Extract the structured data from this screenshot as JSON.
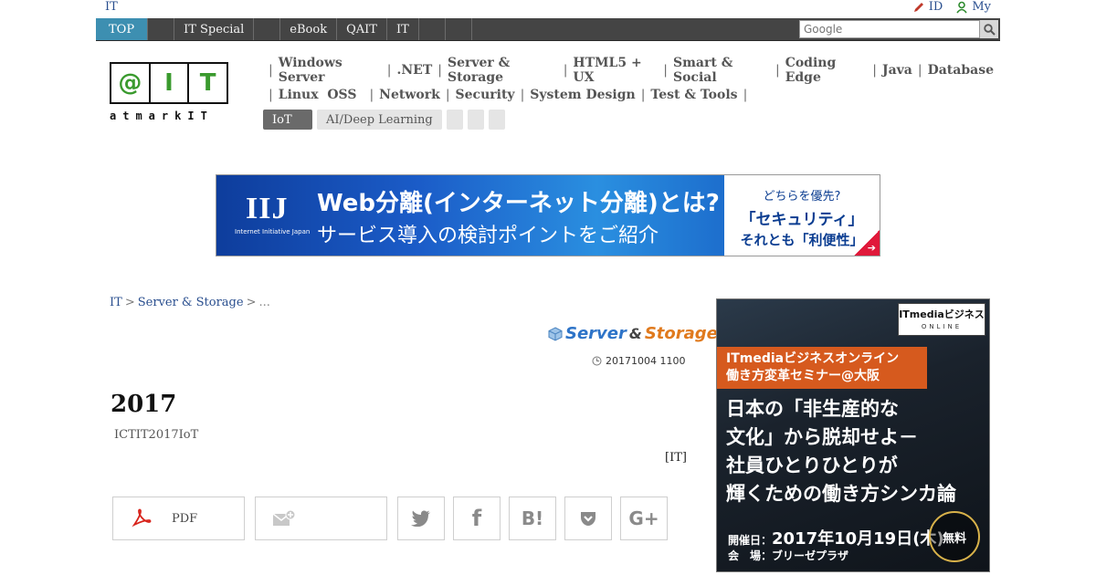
{
  "top_strip": {
    "brand": "IT",
    "links": [
      {
        "label": "ID",
        "icon": "pencil-icon"
      },
      {
        "label": "My",
        "icon": "user-icon"
      }
    ]
  },
  "navbar": {
    "items": [
      {
        "label": "TOP",
        "active": true
      },
      {
        "label": ""
      },
      {
        "label": "IT Special"
      },
      {
        "label": ""
      },
      {
        "label": "eBook"
      },
      {
        "label": "QAIT"
      },
      {
        "label": "IT"
      },
      {
        "label": ""
      },
      {
        "label": ""
      }
    ],
    "search_placeholder": "Google"
  },
  "logo": {
    "boxes": [
      "@",
      "I",
      "T"
    ],
    "tagline": "atmarkIT"
  },
  "categories": {
    "row1": [
      "Windows Server",
      ".NET",
      "Server & Storage",
      "HTML5 + UX",
      "Smart & Social",
      "Coding Edge",
      "Java",
      "Database"
    ],
    "row2": [
      "Linux  OSS",
      "Network",
      "Security",
      "System Design",
      "Test & Tools"
    ],
    "chips": [
      {
        "label": "IoT",
        "style": "dark"
      },
      {
        "label": "AI/Deep Learning",
        "style": "light"
      },
      {
        "label": "",
        "style": "blank"
      },
      {
        "label": "",
        "style": "blank"
      },
      {
        "label": "",
        "style": "blank"
      }
    ]
  },
  "banner": {
    "logo": "IIJ",
    "logo_sub": "Internet Initiative Japan",
    "line1": "Web分離(インターネット分離)とは?",
    "line2": "サービス導入の検討ポイントをご紹介",
    "right1": "どちらを優先?",
    "right2": "「セキュリティ」",
    "right3": "それとも「利便性」"
  },
  "breadcrumb": {
    "items": [
      "IT",
      "Server & Storage"
    ],
    "current": "..."
  },
  "section_logo": {
    "part1": "Server",
    "amp": "&",
    "part2": "Storage"
  },
  "article": {
    "date": "20171004 1100",
    "title": "2017",
    "subtitle": "ICTIT2017IoT",
    "source": "[IT]"
  },
  "share": {
    "pdf_label": "PDF",
    "buttons": [
      {
        "name": "twitter",
        "glyph": "🐦"
      },
      {
        "name": "facebook",
        "glyph": "f"
      },
      {
        "name": "hatena",
        "glyph": "B!"
      },
      {
        "name": "pocket",
        "glyph": "pocket"
      },
      {
        "name": "google-plus",
        "glyph": "G+"
      }
    ]
  },
  "side_ad": {
    "brand_line1": "ITmediaビジネス",
    "brand_line2": "ONLINE",
    "ribbon_line1": "ITmediaビジネスオンライン",
    "ribbon_line2": "働き方変革セミナー@大阪",
    "head_line1": "日本の「非生産的な",
    "head_line2": "文化」から脱却せよ－",
    "head_line3": "社員ひとりひとりが",
    "head_line4": "輝くための働き方シンカ論",
    "date_prefix": "開催日：",
    "date_value": "2017年10月19日(木)",
    "venue": "会　場：ブリーゼプラザ",
    "free": "無料"
  }
}
